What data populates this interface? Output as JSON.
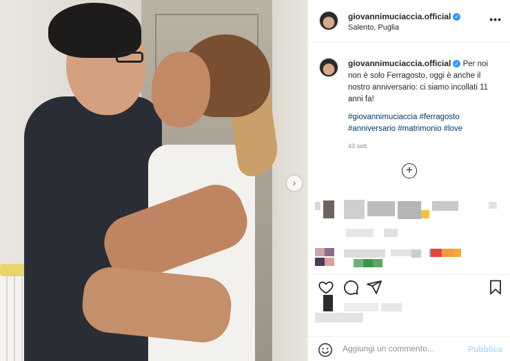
{
  "post": {
    "username": "giovannimuciaccia.official",
    "verified_icon": "verified-badge-icon",
    "location": "Salento, Puglia",
    "more_icon": "more-options-icon",
    "more_glyph": "•••"
  },
  "caption": {
    "username": "giovannimuciaccia.official",
    "text": "Per noi non è solo Ferragosto, oggi è anche il nostro anniversario: ci siamo incollati 11 anni fa!",
    "hashtags": "#giovannimuciaccia #ferragosto #anniversario #matrimonio #love",
    "time": "43 sett.",
    "load_more_glyph": "+"
  },
  "photo": {
    "next_glyph": "›"
  },
  "actions": {
    "like_icon": "heart-icon",
    "comment_icon": "comment-icon",
    "share_icon": "share-icon",
    "save_icon": "bookmark-icon"
  },
  "add_comment": {
    "emoji_icon": "emoji-icon",
    "placeholder": "Aggiungi un commento...",
    "publish_label": "Pubblica"
  },
  "colors": {
    "link": "#00376b",
    "verified": "#3897f0",
    "publish_disabled": "#b3dbff"
  }
}
